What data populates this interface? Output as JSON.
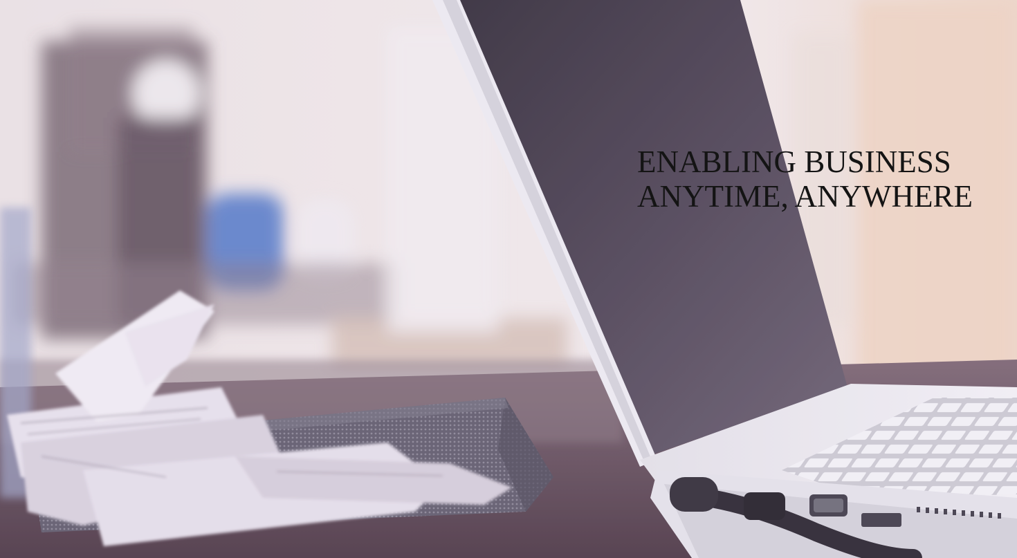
{
  "hero": {
    "headline_line_1": "ENABLING BUSINESS",
    "headline_line_2": "ANYTIME, ANYWHERE"
  },
  "scene": {
    "subject": "laptop on desk with receipts in a mesh tray",
    "palette": {
      "wall_light": "#f3ecec",
      "wall_shadow": "#6d5a64",
      "screen_dark": "#453c49",
      "laptop_body": "#efeff2",
      "desk": "#5a4550",
      "tray": "#6a6673",
      "paper": "#ebe6ee",
      "accent_blue": "#4f78c8",
      "warm_light": "#f3d9c4"
    }
  }
}
